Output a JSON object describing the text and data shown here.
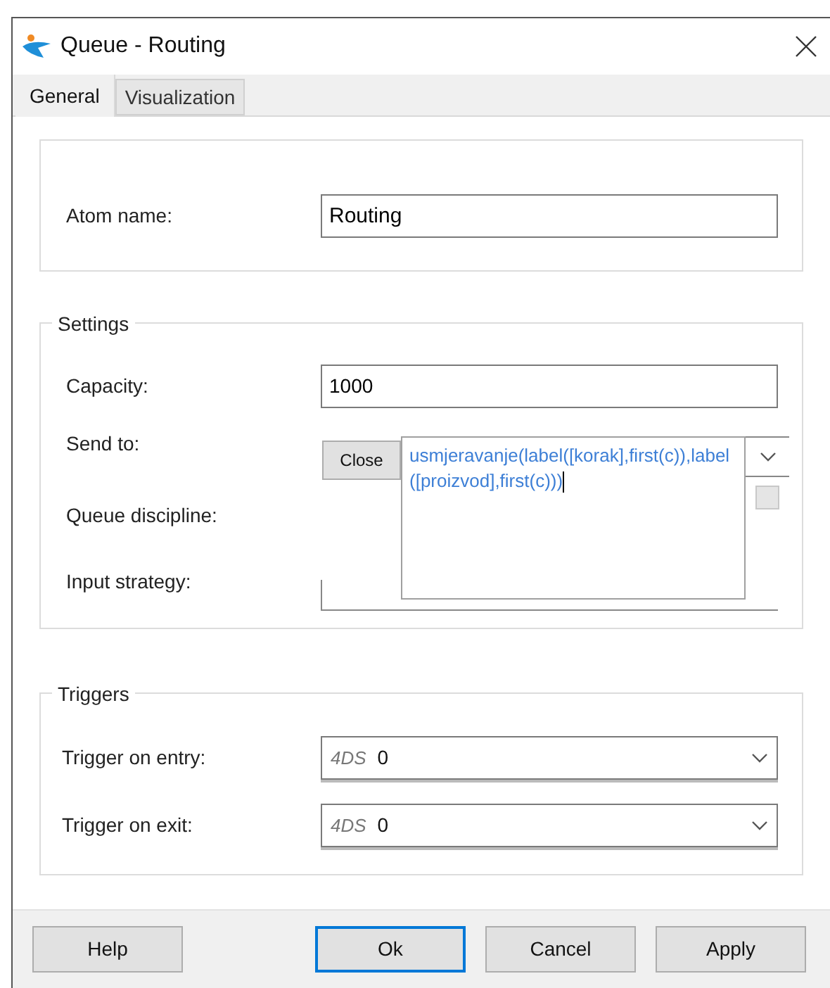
{
  "window": {
    "title": "Queue - Routing"
  },
  "tabs": [
    {
      "label": "General",
      "selected": true
    },
    {
      "label": "Visualization",
      "selected": false
    }
  ],
  "atom_name": {
    "label": "Atom name:",
    "value": "Routing"
  },
  "settings": {
    "title": "Settings",
    "capacity": {
      "label": "Capacity:",
      "value": "1000"
    },
    "send_to": {
      "label": "Send to:",
      "close_button": "Close",
      "editor_text": "usmjeravanje(label([korak],first(c)),label([proizvod],first(c)))",
      "checked": false
    },
    "queue_discipline": {
      "label": "Queue discipline:"
    },
    "input_strategy": {
      "label": "Input strategy:"
    }
  },
  "triggers": {
    "title": "Triggers",
    "items": [
      {
        "label": "Trigger on entry:",
        "prefix": "4DS",
        "value": "0"
      },
      {
        "label": "Trigger on exit:",
        "prefix": "4DS",
        "value": "0"
      }
    ]
  },
  "buttons": [
    {
      "label": "Help",
      "default": false
    },
    {
      "label": "Ok",
      "default": true
    },
    {
      "label": "Cancel",
      "default": false
    },
    {
      "label": "Apply",
      "default": false
    }
  ]
}
